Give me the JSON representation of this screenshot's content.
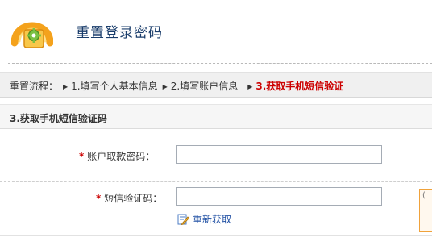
{
  "header": {
    "title": "重置登录密码"
  },
  "process": {
    "label": "重置流程：",
    "steps": [
      "1.填写个人基本信息",
      "2.填写账户信息",
      "3.获取手机短信验证"
    ],
    "current_index": 2
  },
  "section": {
    "title": "3.获取手机短信验证码"
  },
  "form": {
    "required_mark": "*",
    "withdraw_password_label": "账户取款密码：",
    "withdraw_password_value": "",
    "sms_code_label": "短信验证码：",
    "sms_code_value": "",
    "refresh_label": "重新获取"
  },
  "icons": {
    "logo": "lock-gear-icon",
    "step_arrow": "triangle-right-icon",
    "refresh": "refresh-pencil-icon"
  },
  "colors": {
    "title": "#1a3d6b",
    "current_step": "#cc0000",
    "required_mark": "#cc0000",
    "link": "#1f4fa3",
    "tip_border": "#f0a23b"
  }
}
